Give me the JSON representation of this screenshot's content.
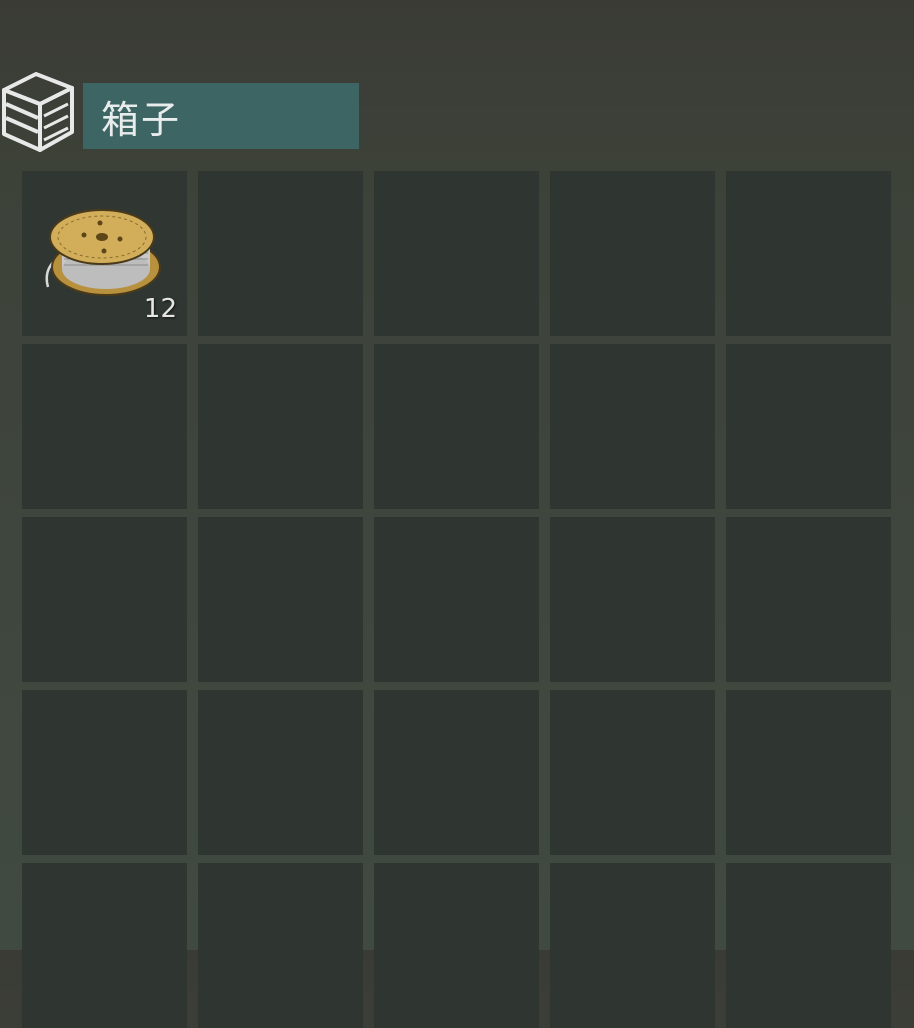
{
  "container": {
    "title": "箱子",
    "icon": "crate-icon",
    "accent_color": "#3d6563"
  },
  "inventory": {
    "columns": 5,
    "slots": [
      {
        "item": "wire-spool-icon",
        "quantity": "12"
      },
      {},
      {},
      {},
      {},
      {},
      {},
      {},
      {},
      {},
      {},
      {},
      {},
      {},
      {},
      {},
      {},
      {},
      {},
      {},
      {},
      {},
      {},
      {},
      {}
    ]
  }
}
